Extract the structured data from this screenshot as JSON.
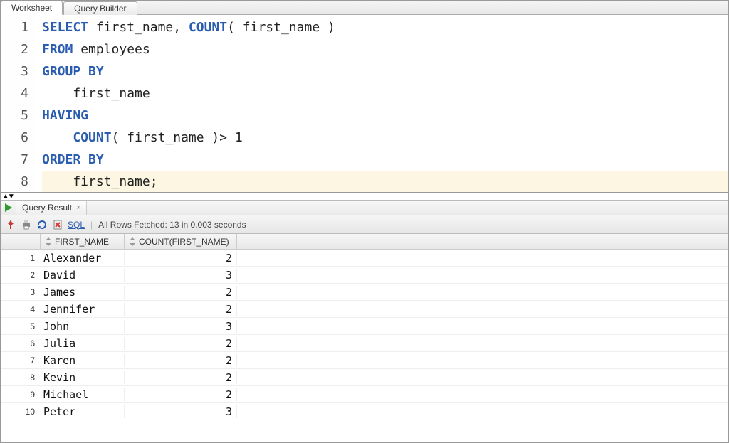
{
  "tabs": {
    "worksheet": "Worksheet",
    "query_builder": "Query Builder"
  },
  "code_lines": [
    {
      "n": "1",
      "tokens": [
        {
          "t": "SELECT",
          "c": "kw"
        },
        {
          "t": " first_name, ",
          "c": "txt"
        },
        {
          "t": "COUNT",
          "c": "kw"
        },
        {
          "t": "( first_name )",
          "c": "txt"
        }
      ]
    },
    {
      "n": "2",
      "tokens": [
        {
          "t": "FROM",
          "c": "kw"
        },
        {
          "t": " employees",
          "c": "txt"
        }
      ]
    },
    {
      "n": "3",
      "tokens": [
        {
          "t": "GROUP BY",
          "c": "kw"
        }
      ]
    },
    {
      "n": "4",
      "tokens": [
        {
          "t": "    first_name",
          "c": "txt"
        }
      ]
    },
    {
      "n": "5",
      "tokens": [
        {
          "t": "HAVING",
          "c": "kw"
        }
      ]
    },
    {
      "n": "6",
      "tokens": [
        {
          "t": "    ",
          "c": "txt"
        },
        {
          "t": "COUNT",
          "c": "kw"
        },
        {
          "t": "( first_name )> 1",
          "c": "txt"
        }
      ]
    },
    {
      "n": "7",
      "tokens": [
        {
          "t": "ORDER BY",
          "c": "kw"
        }
      ]
    },
    {
      "n": "8",
      "tokens": [
        {
          "t": "    first_name;",
          "c": "txt"
        }
      ],
      "current": true
    }
  ],
  "result_tab": {
    "label": "Query Result"
  },
  "toolbar": {
    "sql_label": "SQL",
    "status": "All Rows Fetched: 13 in 0.003 seconds"
  },
  "grid": {
    "columns": [
      "FIRST_NAME",
      "COUNT(FIRST_NAME)"
    ],
    "rows": [
      {
        "n": "1",
        "first_name": "Alexander",
        "count": "2"
      },
      {
        "n": "2",
        "first_name": "David",
        "count": "3"
      },
      {
        "n": "3",
        "first_name": "James",
        "count": "2"
      },
      {
        "n": "4",
        "first_name": "Jennifer",
        "count": "2"
      },
      {
        "n": "5",
        "first_name": "John",
        "count": "3"
      },
      {
        "n": "6",
        "first_name": "Julia",
        "count": "2"
      },
      {
        "n": "7",
        "first_name": "Karen",
        "count": "2"
      },
      {
        "n": "8",
        "first_name": "Kevin",
        "count": "2"
      },
      {
        "n": "9",
        "first_name": "Michael",
        "count": "2"
      },
      {
        "n": "10",
        "first_name": "Peter",
        "count": "3"
      }
    ]
  }
}
